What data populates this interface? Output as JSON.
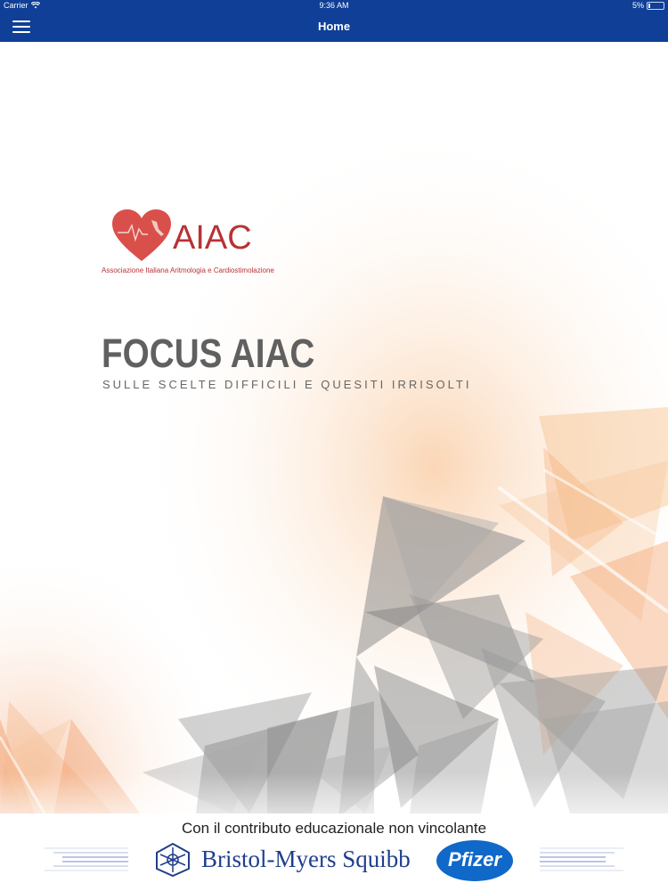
{
  "status_bar": {
    "carrier": "Carrier",
    "time": "9:36 AM",
    "battery": "5%"
  },
  "nav": {
    "title": "Home"
  },
  "brand": {
    "logo_text": "AIAC",
    "logo_subtitle": "Associazione Italiana Aritmologia e Cardiostimolazione",
    "color": "#b83234"
  },
  "hero": {
    "title": "FOCUS AIAC",
    "subtitle": "SULLE SCELTE DIFFICILI E QUESITI IRRISOLTI"
  },
  "footer": {
    "caption": "Con il contributo educazionale non vincolante",
    "sponsor_1": "Bristol-Myers Squibb",
    "sponsor_2": "Pfizer"
  },
  "colors": {
    "nav_bar": "#0f3f97",
    "title_gray": "#606060",
    "pfizer_blue": "#1068c9",
    "bms_blue": "#1f3f8c"
  },
  "icons": [
    "menu-icon",
    "wifi-icon",
    "battery-icon"
  ]
}
